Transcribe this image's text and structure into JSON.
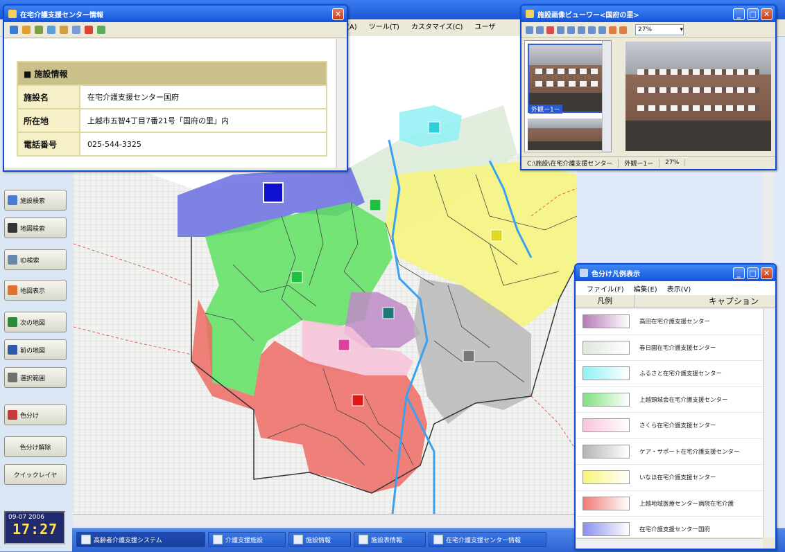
{
  "app": {
    "menu": [
      "(A)",
      "ツール(T)",
      "カスタマイズ(C)",
      "ユーザ"
    ]
  },
  "left_buttons": [
    {
      "label": "施設検索",
      "icon": "magnifier-icon",
      "color": "#4a7bd0"
    },
    {
      "label": "地図検索",
      "icon": "binoculars-icon",
      "color": "#333333"
    },
    {
      "label": "ID検索",
      "icon": "id-search-icon",
      "color": "#6688aa"
    },
    {
      "label": "地図表示",
      "icon": "map-display-icon",
      "color": "#e07030"
    },
    {
      "label": "次の地図",
      "icon": "next-map-icon",
      "color": "#2e8a3a"
    },
    {
      "label": "前の地図",
      "icon": "prev-map-icon",
      "color": "#2e5aa8"
    },
    {
      "label": "選択範囲",
      "icon": "selection-icon",
      "color": "#707070"
    },
    {
      "label": "色分け",
      "icon": "color-code-icon",
      "color": "#c83a3a"
    },
    {
      "label": "色分け解除",
      "icon": "",
      "color": ""
    },
    {
      "label": "クイックレイヤ",
      "icon": "",
      "color": ""
    }
  ],
  "clock": {
    "date": "09-07 2006",
    "time": "17:27"
  },
  "taskbar": [
    {
      "label": "高齢者介護支援システム",
      "active": true
    },
    {
      "label": "介護支援施設",
      "active": false
    },
    {
      "label": "施設情報",
      "active": false
    },
    {
      "label": "施設表情報",
      "active": false
    },
    {
      "label": "在宅介護支援センター情報",
      "active": false
    }
  ],
  "info_window": {
    "title": "在宅介護支援センター情報",
    "section": "■ 施設情報",
    "rows": [
      {
        "key": "施設名",
        "value": "在宅介護支援センター国府"
      },
      {
        "key": "所在地",
        "value": "上越市五智4丁目7番21号「国府の里」内"
      },
      {
        "key": "電話番号",
        "value": "025-544-3325"
      }
    ]
  },
  "viewer": {
    "title": "施設画像ビューワー<国府の里>",
    "zoom": "27%",
    "thumb_label": "外観ー1ー",
    "status": [
      "C:\\施設\\在宅介護支援センター",
      "外観ー1ー",
      "27%"
    ]
  },
  "legend": {
    "title": "色分け凡例表示",
    "menu": [
      "ファイル(F)",
      "編集(E)",
      "表示(V)"
    ],
    "col1": "凡例",
    "col2": "キャプション",
    "items": [
      {
        "color": "#b77ab8",
        "name": "高田在宅介護支援センター"
      },
      {
        "color": "#dfe8dc",
        "name": "春日園在宅介護支援センター"
      },
      {
        "color": "#8ff2f6",
        "name": "ふるさと在宅介護支援センター"
      },
      {
        "color": "#7fe07f",
        "name": "上越頸城会在宅介護支援センター"
      },
      {
        "color": "#f9c4dc",
        "name": "さくら在宅介護支援センター"
      },
      {
        "color": "#b4b4b4",
        "name": "ケア・サポート在宅介護支援センター"
      },
      {
        "color": "#f8f57a",
        "name": "いなほ在宅介護支援センター"
      },
      {
        "color": "#f07a74",
        "name": "上越地域医療センター病院在宅介護"
      },
      {
        "color": "#8a90ee",
        "name": "在宅介護支援センター国府"
      }
    ]
  },
  "map": {
    "regions": [
      {
        "name": "region-blue",
        "color": "#6a6de0"
      },
      {
        "name": "region-green",
        "color": "#5fe060"
      },
      {
        "name": "region-yellow",
        "color": "#f7f47a"
      },
      {
        "name": "region-gray",
        "color": "#b8b8b8"
      },
      {
        "name": "region-red",
        "color": "#ee6a64"
      },
      {
        "name": "region-pink",
        "color": "#f7c1d8"
      },
      {
        "name": "region-purple",
        "color": "#c08ac8"
      },
      {
        "name": "region-cyan",
        "color": "#90f0f4"
      },
      {
        "name": "region-lightgreen",
        "color": "#dcebd8"
      }
    ],
    "markers": [
      {
        "name": "marker-blue",
        "color": "#1010d0"
      },
      {
        "name": "marker-green-north",
        "color": "#20c040"
      },
      {
        "name": "marker-cyan",
        "color": "#30d0d8"
      },
      {
        "name": "marker-green-west",
        "color": "#20c040"
      },
      {
        "name": "marker-yellow",
        "color": "#e0d820"
      },
      {
        "name": "marker-teal",
        "color": "#207878"
      },
      {
        "name": "marker-pink",
        "color": "#e040a0"
      },
      {
        "name": "marker-gray",
        "color": "#787878"
      },
      {
        "name": "marker-red",
        "color": "#e01818"
      }
    ]
  }
}
